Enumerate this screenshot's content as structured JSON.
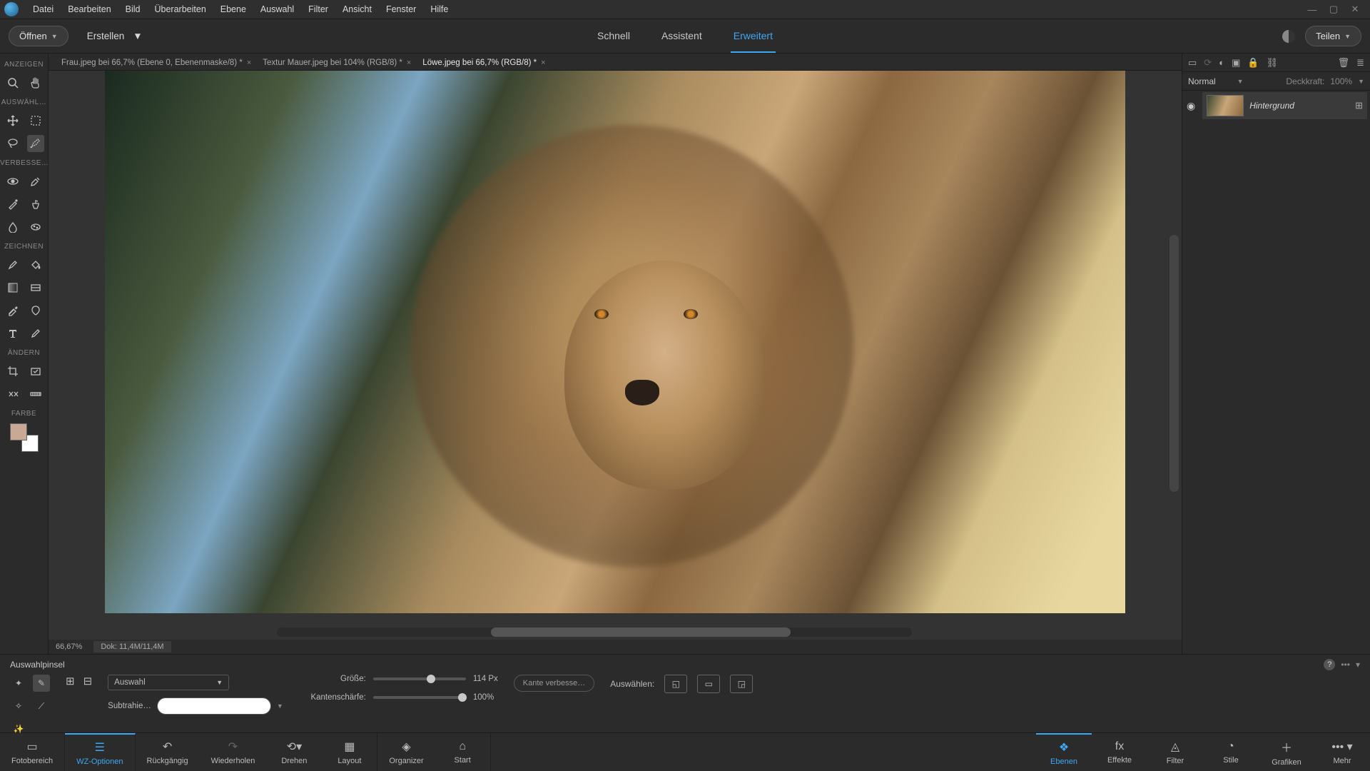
{
  "menu": [
    "Datei",
    "Bearbeiten",
    "Bild",
    "Überarbeiten",
    "Ebene",
    "Auswahl",
    "Filter",
    "Ansicht",
    "Fenster",
    "Hilfe"
  ],
  "topbar": {
    "open": "Öffnen",
    "create": "Erstellen",
    "modes": [
      "Schnell",
      "Assistent",
      "Erweitert"
    ],
    "active_mode": 2,
    "share": "Teilen"
  },
  "tool_sections": {
    "view": "ANZEIGEN",
    "select": "AUSWÄHL…",
    "enhance": "VERBESSE…",
    "draw": "ZEICHNEN",
    "modify": "ÄNDERN",
    "color": "FARBE"
  },
  "doc_tabs": [
    {
      "label": "Frau.jpeg bei 66,7% (Ebene 0, Ebenenmaske/8) *",
      "active": false
    },
    {
      "label": "Textur Mauer.jpeg bei 104% (RGB/8) *",
      "active": false
    },
    {
      "label": "Löwe.jpeg bei 66,7% (RGB/8) *",
      "active": true
    }
  ],
  "status": {
    "zoom": "66,67%",
    "doc": "Dok: 11,4M/11,4M"
  },
  "layers": {
    "blend_mode": "Normal",
    "opacity_label": "Deckkraft:",
    "opacity_value": "100%",
    "layer_name": "Hintergrund"
  },
  "tool_options": {
    "title": "Auswahlpinsel",
    "mode_label": "Auswahl",
    "subtract": "Subtrahie…",
    "size_label": "Größe:",
    "size_value": "114 Px",
    "edge_label": "Kantenschärfe:",
    "edge_value": "100%",
    "refine": "Kante verbesse…",
    "select_label": "Auswählen:"
  },
  "bottombar_left": [
    "Fotobereich",
    "WZ-Optionen",
    "Rückgängig",
    "Wiederholen",
    "Drehen",
    "Layout",
    "Organizer",
    "Start"
  ],
  "bottombar_right": [
    "Ebenen",
    "Effekte",
    "Filter",
    "Stile",
    "Grafiken",
    "Mehr"
  ]
}
